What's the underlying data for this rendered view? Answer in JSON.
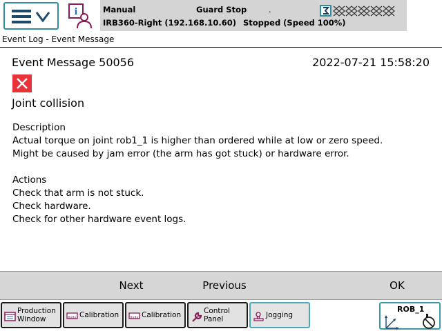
{
  "status": {
    "mode": "Manual",
    "guard": "Guard Stop",
    "dot": ".",
    "robot": "IRB360-Right (192.168.10.60)",
    "state": "Stopped (Speed 100%)"
  },
  "view_title": "Event Log - Event Message",
  "message": {
    "title": "Event Message 50056",
    "timestamp": "2022-07-21 15:58:20",
    "heading": "Joint collision",
    "description_label": "Description",
    "description_lines": [
      "Actual torque on joint rob1_1 is higher than ordered while at low or zero speed.",
      "Might be caused by jam error (the arm has got stuck) or hardware error."
    ],
    "actions_label": "Actions",
    "action_lines": [
      "Check that arm is not stuck.",
      "Check hardware.",
      "Check for other hardware event logs."
    ]
  },
  "commands": {
    "next": "Next",
    "previous": "Previous",
    "ok": "OK"
  },
  "taskbar": {
    "items": [
      {
        "label": "Production Window",
        "icon": "production-window-icon"
      },
      {
        "label": "Calibration",
        "icon": "calibration-icon"
      },
      {
        "label": "Calibration",
        "icon": "calibration-icon"
      },
      {
        "label": "Control Panel",
        "icon": "wrench-icon"
      },
      {
        "label": "Jogging",
        "icon": "jogging-icon"
      }
    ],
    "quickset_label": "ROB_1"
  },
  "colors": {
    "accent": "#2f8fa2",
    "status_bg": "#d4d4d4",
    "error_red": "#e8333a",
    "command_bar_bg": "#d6d6d6"
  }
}
